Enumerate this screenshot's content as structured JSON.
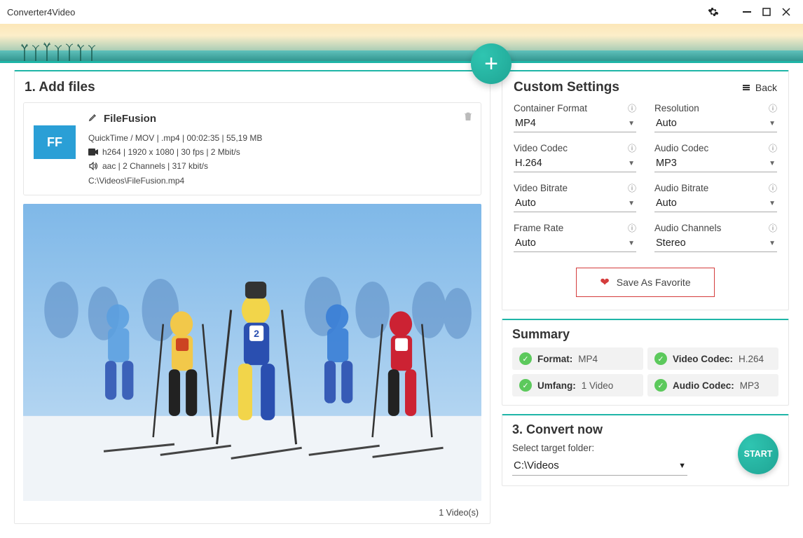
{
  "app_title": "Converter4Video",
  "left": {
    "title": "1. Add files",
    "file": {
      "thumb": "FF",
      "name": "FileFusion",
      "line1": "QuickTime / MOV | .mp4 | 00:02:35 | 55,19 MB",
      "line2": "h264 | 1920 x 1080 | 30 fps | 2 Mbit/s",
      "line3": "aac | 2 Channels | 317 kbit/s",
      "path": "C:\\Videos\\FileFusion.mp4"
    },
    "video_count": "1 Video(s)"
  },
  "settings": {
    "title": "Custom Settings",
    "back": "Back",
    "fields": {
      "container": {
        "label": "Container Format",
        "value": "MP4"
      },
      "resolution": {
        "label": "Resolution",
        "value": "Auto"
      },
      "vcodec": {
        "label": "Video Codec",
        "value": "H.264"
      },
      "acodec": {
        "label": "Audio Codec",
        "value": "MP3"
      },
      "vbitrate": {
        "label": "Video Bitrate",
        "value": "Auto"
      },
      "abitrate": {
        "label": "Audio Bitrate",
        "value": "Auto"
      },
      "fps": {
        "label": "Frame Rate",
        "value": "Auto"
      },
      "channels": {
        "label": "Audio Channels",
        "value": "Stereo"
      }
    },
    "favorite": "Save As Favorite"
  },
  "summary": {
    "title": "Summary",
    "format_k": "Format:",
    "format_v": "MP4",
    "vcodec_k": "Video Codec:",
    "vcodec_v": "H.264",
    "umfang_k": "Umfang:",
    "umfang_v": "1 Video",
    "acodec_k": "Audio Codec:",
    "acodec_v": "MP3"
  },
  "convert": {
    "title": "3. Convert now",
    "subtitle": "Select target folder:",
    "folder": "C:\\Videos",
    "start": "START"
  }
}
